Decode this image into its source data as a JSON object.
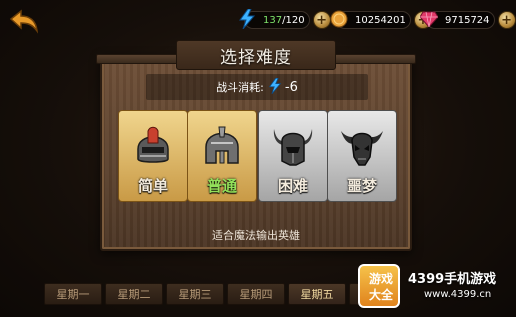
{
  "topbar": {
    "energy": {
      "current": "137",
      "max": "/120"
    },
    "gold": "10254201",
    "gems": "9715724",
    "plus_label": "+"
  },
  "panel": {
    "title": "选择难度",
    "cost_label": "战斗消耗:",
    "cost_value": "-6",
    "hint": "适合魔法输出英雄"
  },
  "difficulty": [
    {
      "label": "简单",
      "icon": "knight-helmet-icon",
      "selected": false
    },
    {
      "label": "普通",
      "icon": "spartan-helmet-icon",
      "selected": true
    },
    {
      "label": "困难",
      "icon": "horned-helmet-icon",
      "selected": false
    },
    {
      "label": "噩梦",
      "icon": "demon-skull-icon",
      "selected": false
    }
  ],
  "tabs": [
    "星期一",
    "星期二",
    "星期三",
    "星期四",
    "星期五",
    "星"
  ],
  "watermark": {
    "logo_top": "游戏",
    "logo_bottom": "大全",
    "text": "4399手机游戏",
    "url": "www.4399.cn"
  },
  "colors": {
    "energy_current": "#7ee26a",
    "normal_label": "#93e05a",
    "card_gold": "#e0b868",
    "card_silver": "#cfcfcf"
  }
}
